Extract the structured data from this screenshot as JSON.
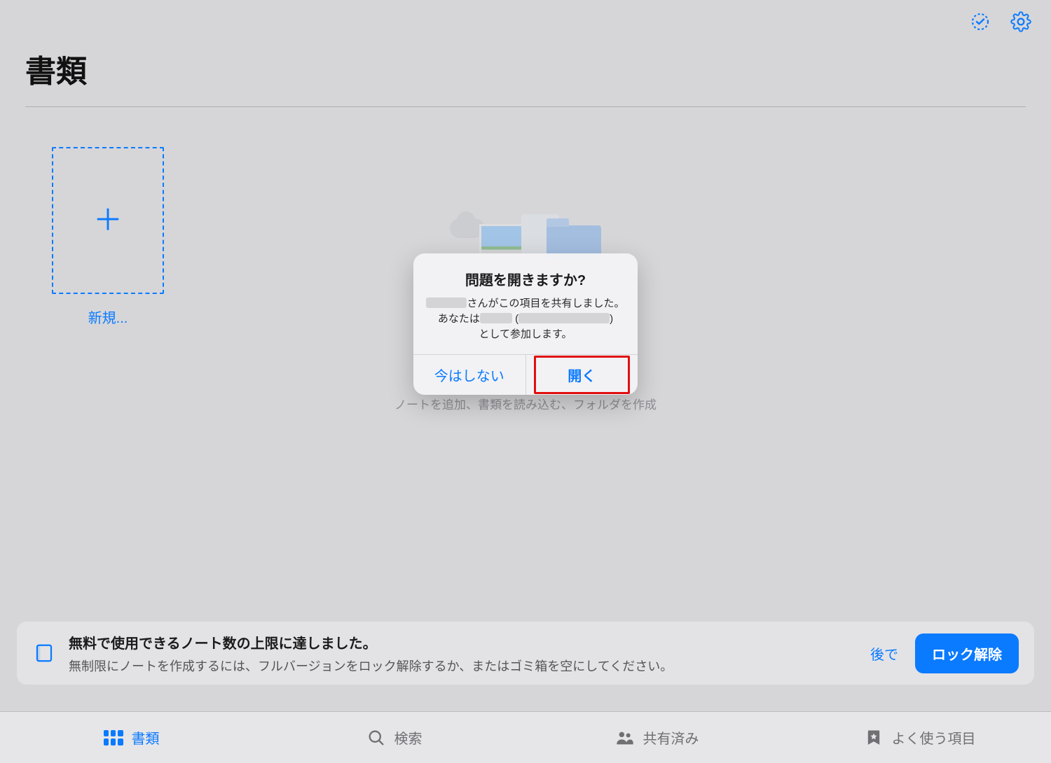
{
  "header": {
    "title": "書類"
  },
  "newTile": {
    "label": "新規..."
  },
  "hintLine": "ノートを追加、書類を読み込む、フォルダを作成",
  "dialog": {
    "title": "問題を開きますか?",
    "msg_part1": "さんがこの項目を共有しました。",
    "msg_part2a": "あなたは",
    "msg_part2b": "(",
    "msg_part2c": ")",
    "msg_part3": "として参加します。",
    "notNow": "今はしない",
    "open": "開く"
  },
  "banner": {
    "title": "無料で使用できるノート数の上限に達しました。",
    "sub": "無制限にノートを作成するには、フルバージョンをロック解除するか、またはゴミ箱を空にしてください。",
    "later": "後で",
    "unlock": "ロック解除"
  },
  "nav": {
    "documents": "書類",
    "search": "検索",
    "shared": "共有済み",
    "favorites": "よく使う項目"
  },
  "colors": {
    "accent": "#0a7aff",
    "highlight": "#e10f0f"
  }
}
